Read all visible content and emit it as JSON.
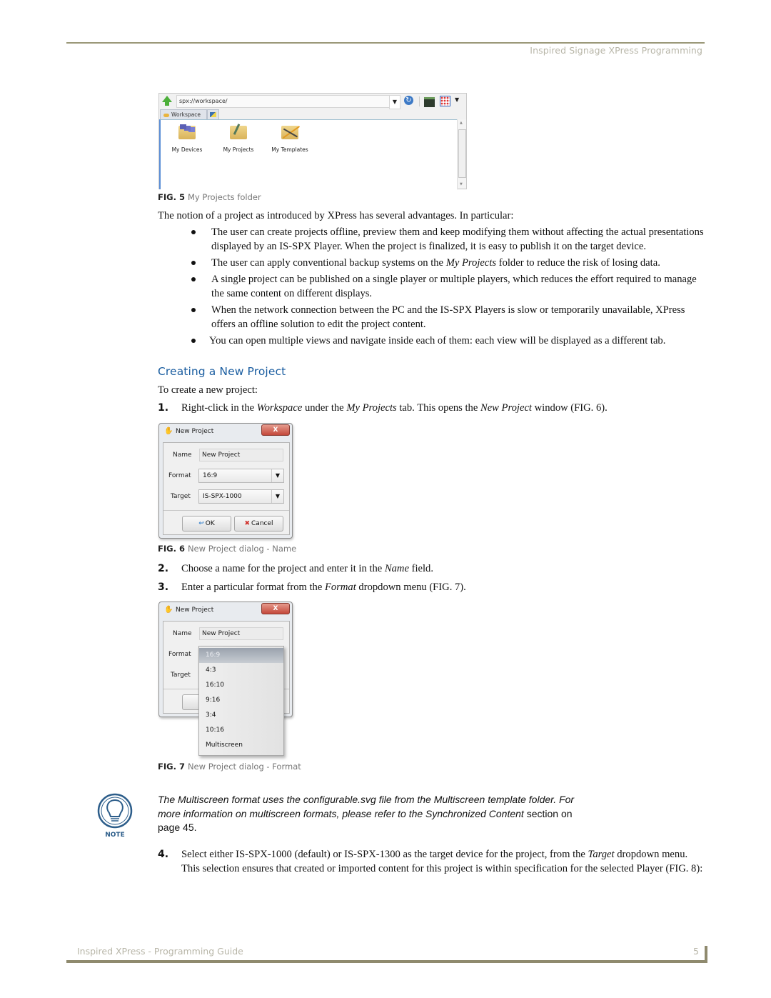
{
  "header": {
    "running_title": "Inspired Signage XPress Programming"
  },
  "figures": {
    "fig5": {
      "explorer": {
        "address": "spx://workspace/",
        "address_dropdown_icon": "chevron-down-icon",
        "toolbar_icons": [
          "up-arrow-icon",
          "refresh-icon",
          "folder-icon",
          "view-grid-icon",
          "chevron-down-icon"
        ],
        "tabs": [
          {
            "label": "Workspace",
            "active": true
          },
          {
            "label": "",
            "icon": "image-icon"
          }
        ],
        "items": [
          {
            "label": "My Devices",
            "icon": "devices-folder-icon"
          },
          {
            "label": "My Projects",
            "icon": "projects-folder-icon"
          },
          {
            "label": "My Templates",
            "icon": "templates-folder-icon"
          }
        ]
      },
      "caption_num": "FIG. 5",
      "caption_text": "My Projects folder"
    },
    "fig6": {
      "dialog": {
        "title": "New Project",
        "close_label": "X",
        "name_label": "Name",
        "name_value": "New Project",
        "format_label": "Format",
        "format_value": "16:9",
        "target_label": "Target",
        "target_value": "IS-SPX-1000",
        "ok_label": "OK",
        "cancel_label": "Cancel"
      },
      "caption_num": "FIG. 6",
      "caption_text": "New Project dialog - Name"
    },
    "fig7": {
      "dialog": {
        "title": "New Project",
        "close_label": "X",
        "name_label": "Name",
        "name_value": "New Project",
        "format_label": "Format",
        "target_label": "Target"
      },
      "format_options": [
        "16:9",
        "4:3",
        "16:10",
        "9:16",
        "3:4",
        "10:16",
        "Multiscreen"
      ],
      "selected_option": "16:9",
      "caption_num": "FIG. 7",
      "caption_text": "New Project dialog - Format"
    }
  },
  "body": {
    "intro": "The notion of a project as introduced by XPress has several advantages. In particular:",
    "bullets": [
      {
        "parts": [
          "The user can create projects offline, preview them and keep modifying them without affecting the actual presentations displayed by an IS-SPX Player. When the project is finalized, it is easy to publish it on the target device."
        ]
      },
      {
        "before": "The user can apply conventional backup systems on the ",
        "em": "My Projects",
        "after": " folder to reduce the risk of losing data."
      },
      {
        "parts": [
          "A single project can be published on a single player or multiple players, which reduces the effort required to manage the same content on different displays."
        ]
      },
      {
        "parts": [
          "When the network connection between the PC and the IS-SPX Players is slow or temporarily unavailable, XPress offers an offline solution to edit the project content."
        ]
      },
      {
        "parts": [
          "You can open multiple views and navigate inside each of them: each view will be displayed as a different tab."
        ]
      }
    ],
    "section_heading": "Creating a New Project",
    "section_intro": "To create a new project:",
    "steps": [
      {
        "num": "1.",
        "t1": "Right-click in the ",
        "e1": "Workspace",
        "t2": " under the ",
        "e2": "My Projects",
        "t3": " tab. This opens the ",
        "e3": "New Project",
        "t4": " window (FIG. 6)."
      },
      {
        "num": "2.",
        "t1": "Choose a name for the project and enter it in the ",
        "e1": "Name",
        "t2": " field."
      },
      {
        "num": "3.",
        "t1": "Enter a particular format from the ",
        "e1": "Format",
        "t2": " dropdown menu (FIG. 7)."
      },
      {
        "num": "4.",
        "t1": "Select either IS-SPX-1000 (default) or IS-SPX-1300 as the target device for the project, from the ",
        "e1": "Target",
        "t2": " dropdown menu. This selection ensures that created or imported content for this project is within specification for the selected Player (FIG. 8):"
      }
    ],
    "note": {
      "label": "NOTE",
      "italic": "The Multiscreen format uses the configurable.svg file from the Multiscreen template folder. For more information on multiscreen formats, please refer to the Synchronized Content",
      "plain": " section on page 45."
    }
  },
  "footer": {
    "guide_title": "Inspired XPress - Programming Guide",
    "page_number": "5"
  },
  "colors": {
    "rule": "#9a9878",
    "heading": "#1a5da0",
    "running_text": "#b8b6a8"
  }
}
